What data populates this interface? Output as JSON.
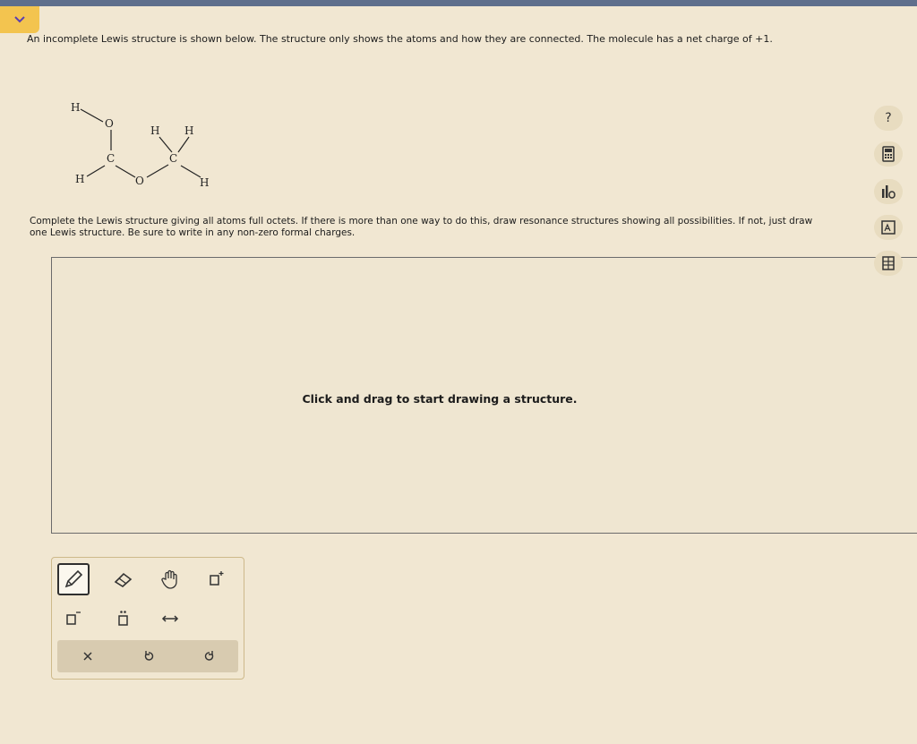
{
  "question": {
    "text": "An incomplete Lewis structure is shown below. The structure only shows the atoms and how they are connected. The molecule has a net charge of +1."
  },
  "molecule": {
    "atoms": {
      "h_top": "H",
      "o_top": "O",
      "c_left": "C",
      "h_left": "H",
      "o_mid": "O",
      "c_right": "C",
      "h_up1": "H",
      "h_up2": "H",
      "h_right": "H"
    }
  },
  "instructions": {
    "text": "Complete the Lewis structure giving all atoms full octets. If there is more than one way to do this, draw resonance structures showing all possibilities. If not, just draw one Lewis structure. Be sure to write in any non-zero formal charges."
  },
  "canvas": {
    "hint": "Click and drag to start drawing a structure."
  },
  "side_tools": {
    "help_label": "?",
    "icons": [
      "help-icon",
      "calculator-icon",
      "bar-chart-icon",
      "periodic-table-icon",
      "reference-icon"
    ]
  },
  "toolbox": {
    "tools": [
      "pencil-icon",
      "eraser-icon",
      "hand-icon",
      "positive-charge-icon",
      "negative-charge-icon",
      "lone-pair-icon",
      "arrow-icon"
    ],
    "actions": [
      "clear-icon",
      "undo-icon",
      "redo-icon"
    ]
  },
  "colors": {
    "background": "#f1e7d2",
    "accent_tab": "#f3c44f",
    "top_stripe": "#5f6f8c"
  }
}
